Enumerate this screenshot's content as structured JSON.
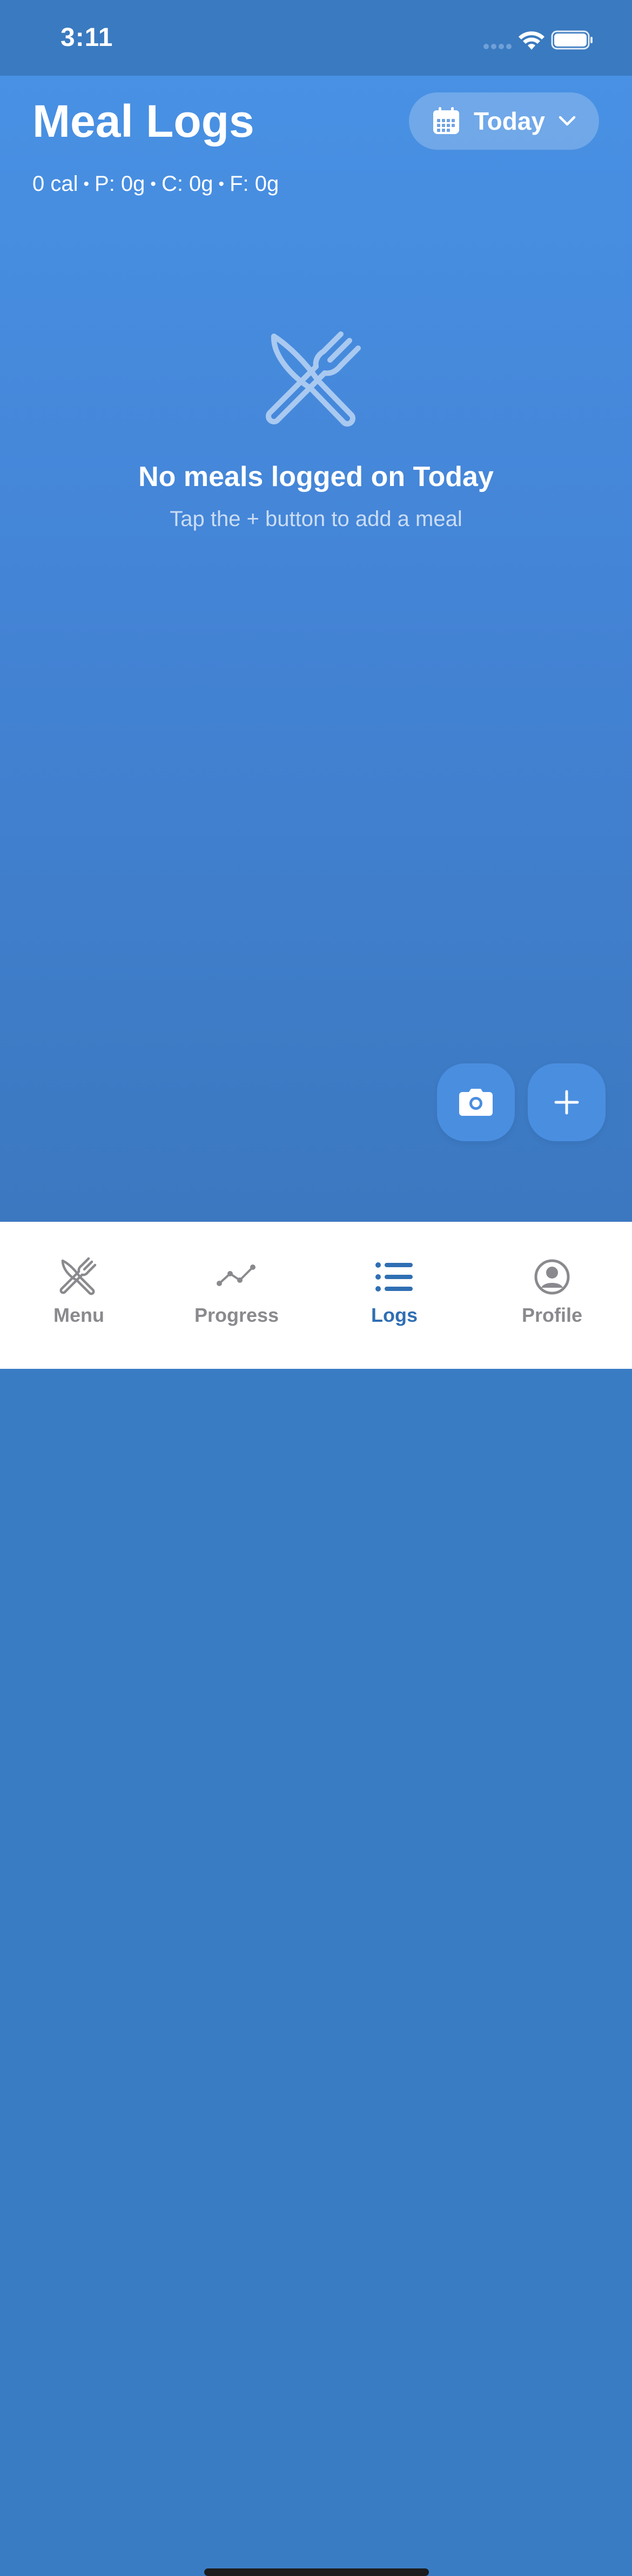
{
  "status_bar": {
    "time": "3:11"
  },
  "header": {
    "title": "Meal Logs",
    "date_selector": {
      "label": "Today",
      "icon": "calendar-icon"
    }
  },
  "summary": {
    "calories": "0 cal",
    "protein": "P: 0g",
    "carbs": "C: 0g",
    "fat": "F: 0g"
  },
  "empty_state": {
    "icon": "fork-knife-icon",
    "title": "No meals logged on Today",
    "subtitle": "Tap the + button to add a meal"
  },
  "actions": {
    "camera_icon": "camera-icon",
    "add_icon": "plus-icon"
  },
  "tab_bar": {
    "items": [
      {
        "label": "Menu",
        "icon": "fork-knife-icon",
        "active": false
      },
      {
        "label": "Progress",
        "icon": "chart-line-icon",
        "active": false
      },
      {
        "label": "Logs",
        "icon": "list-icon",
        "active": true
      },
      {
        "label": "Profile",
        "icon": "profile-icon",
        "active": false
      }
    ]
  },
  "colors": {
    "primary_blue": "#4891e4",
    "tab_active": "#2f6fb3",
    "tab_inactive": "#8a8a8e"
  }
}
